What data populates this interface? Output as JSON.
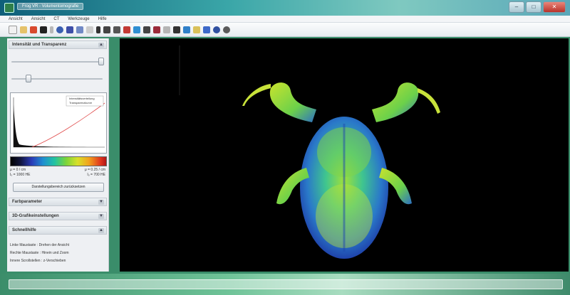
{
  "window": {
    "title": "Frog VR - Volumentomografie",
    "buttons": {
      "minimize": "–",
      "maximize": "□",
      "close": "✕"
    }
  },
  "menu": {
    "items": [
      "Ansicht",
      "Ansicht",
      "CT",
      "Werkzeuge",
      "Hilfe"
    ]
  },
  "panel": {
    "section_intensity": {
      "label": "Intensität und Transparenz",
      "chevron": "▲"
    },
    "histogram": {
      "legend_1": "Intensitätsverteilung",
      "legend_2": "Transparenzkurve"
    },
    "values": {
      "r1_left": "μ = 0 / cm",
      "r1_right": "μ = 0.25 / cm",
      "r2_left": "Iₒ = 1000 HE",
      "r2_right": "Iₒ = 700 HE"
    },
    "reset_button": "Darstellungsbereich zurücksetzen",
    "section_colors": {
      "label": "Farbparameter",
      "chevron": "▼"
    },
    "section_3d": {
      "label": "3D-Grafikeinstellungen",
      "chevron": "▼"
    },
    "section_help": {
      "label": "Schnellhilfe",
      "chevron": "▲"
    },
    "help_lines": [
      "Linke Maustaste : Drehen der Ansicht",
      "Rechte Maustaste : Hinein und Zoom",
      "Innere Scrollstellen : z-Verschieben"
    ]
  },
  "toolbar": {
    "icons": [
      "new-file-icon",
      "open-folder-icon",
      "save-icon",
      "print-icon",
      "cut-icon",
      "copy-icon",
      "paste-icon",
      "undo-icon",
      "rotate-icon",
      "play-icon",
      "stop-icon",
      "record-icon",
      "color-icon",
      "zoom-in-icon",
      "zoom-out-icon",
      "crop-icon",
      "window-icon",
      "layers-icon",
      "split-icon",
      "export-icon",
      "info-icon",
      "settings-icon",
      "help-icon"
    ]
  },
  "colors": {
    "accent": "#2f7f4a",
    "viewport_bg": "#000000"
  }
}
